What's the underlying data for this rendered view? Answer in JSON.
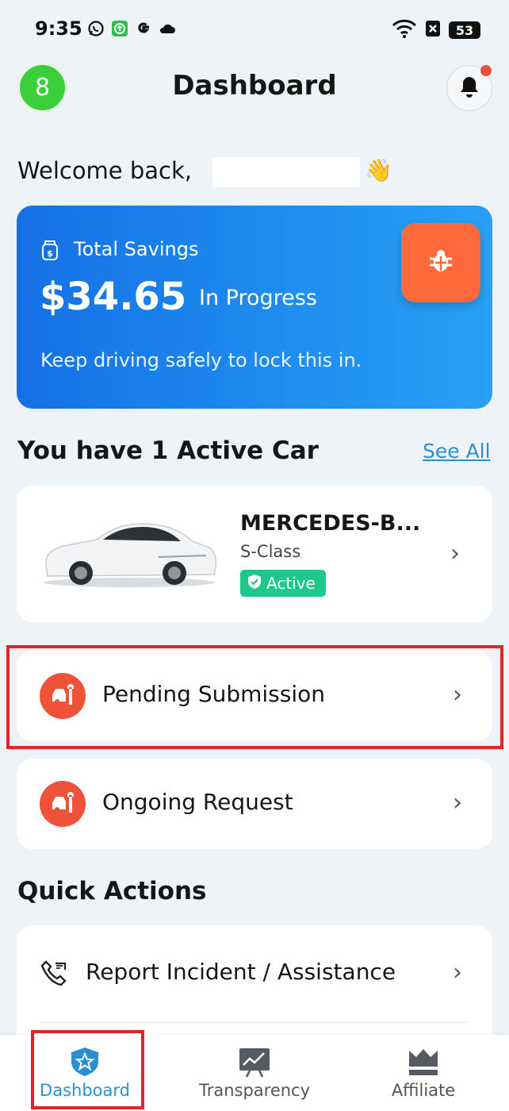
{
  "status_bar": {
    "time": "9:35",
    "battery": "53",
    "icons": [
      "whatsapp-icon",
      "upload-app-icon",
      "google-icon",
      "cloud-icon",
      "wifi-icon",
      "signal-x-icon",
      "battery-icon"
    ]
  },
  "header": {
    "avatar_text": "8",
    "title": "Dashboard",
    "notification_dot_color": "#ef4f3c"
  },
  "welcome": {
    "text": "Welcome back,",
    "emoji": "👋"
  },
  "savings": {
    "label": "Total Savings",
    "amount": "$34.65",
    "status": "In Progress",
    "note": "Keep driving safely to lock this in.",
    "card_color": "#1f8ff0",
    "bug_button_color": "#ff6a3d"
  },
  "cars": {
    "title": "You have 1 Active Car",
    "see_all": "See All",
    "items": [
      {
        "name": "MERCEDES-B...",
        "model": "S-Class",
        "status": "Active"
      }
    ]
  },
  "requests": [
    {
      "label": "Pending Submission"
    },
    {
      "label": "Ongoing Request"
    }
  ],
  "quick_actions": {
    "title": "Quick Actions",
    "items": [
      {
        "label": "Report Incident / Assistance"
      }
    ]
  },
  "bottom_nav": {
    "active": "Dashboard",
    "active_color": "#2b8fd6",
    "items": [
      {
        "label": "Dashboard",
        "icon": "star-shield-icon"
      },
      {
        "label": "Transparency",
        "icon": "chart-board-icon"
      },
      {
        "label": "Affiliate",
        "icon": "crown-icon"
      }
    ]
  }
}
